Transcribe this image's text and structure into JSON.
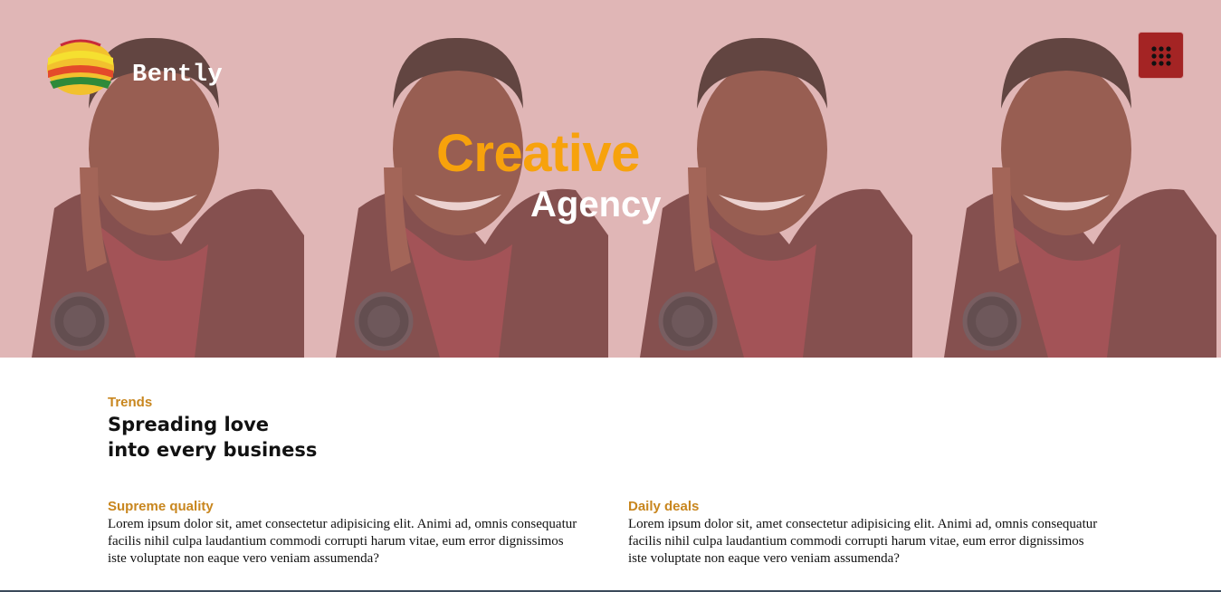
{
  "brand": {
    "name": "Bently"
  },
  "header": {
    "menu_icon": "grid-menu-icon"
  },
  "hero": {
    "headline": "Creative",
    "subheadline": "Agency"
  },
  "intro": {
    "kicker": "Trends",
    "title_line1": "Spreading love",
    "title_line2": "into every business"
  },
  "features": [
    {
      "title": "Supreme quality",
      "text": "Lorem ipsum dolor sit, amet consectetur adipisicing elit. Animi ad, omnis consequatur facilis nihil culpa laudantium commodi corrupti harum vitae, eum error dignissimos iste voluptate non eaque vero veniam assumenda?"
    },
    {
      "title": "Daily deals",
      "text": "Lorem ipsum dolor sit, amet consectetur adipisicing elit. Animi ad, omnis consequatur facilis nihil culpa laudantium commodi corrupti harum vitae, eum error dignissimos iste voluptate non eaque vero veniam assumenda?"
    }
  ],
  "colors": {
    "accent": "#f7a20c",
    "kicker": "#c8861e",
    "menu_button": "#a42424",
    "hero_background": "#e3bcbc"
  }
}
